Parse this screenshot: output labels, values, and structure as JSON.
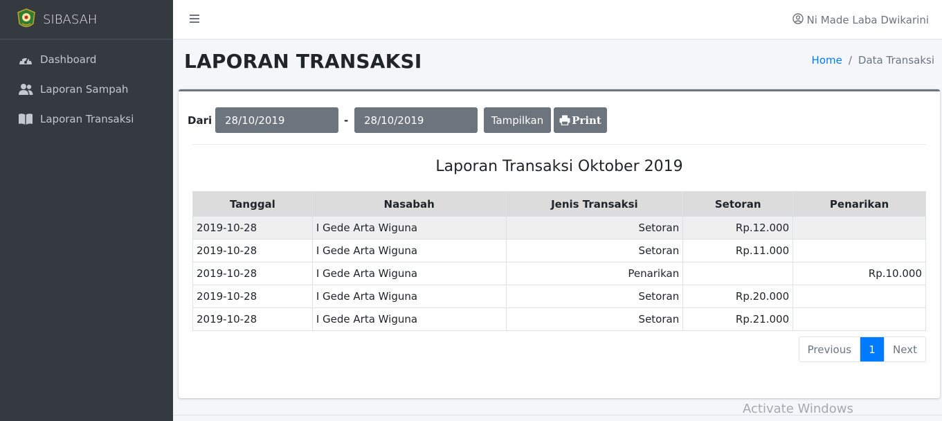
{
  "app": {
    "brand": "SIBASAH"
  },
  "sidebar": {
    "items": [
      {
        "label": "Dashboard",
        "icon": "tachometer-icon"
      },
      {
        "label": "Laporan Sampah",
        "icon": "users-icon"
      },
      {
        "label": "Laporan Transaksi",
        "icon": "book-icon"
      }
    ]
  },
  "navbar": {
    "user": "Ni Made Laba Dwikarini"
  },
  "header": {
    "title": "LAPORAN TRANSAKSI",
    "breadcrumb": {
      "home": "Home",
      "separator": "/",
      "current": "Data Transaksi"
    }
  },
  "filter": {
    "label": "Dari",
    "from_value": "28/10/2019",
    "separator": "-",
    "to_value": "28/10/2019",
    "show_label": "Tampilkan",
    "print_label": "Print"
  },
  "report": {
    "title": "Laporan Transaksi Oktober 2019",
    "columns": [
      "Tanggal",
      "Nasabah",
      "Jenis Transaksi",
      "Setoran",
      "Penarikan"
    ],
    "rows": [
      [
        "2019-10-28",
        "I Gede Arta Wiguna",
        "Setoran",
        "Rp.12.000",
        ""
      ],
      [
        "2019-10-28",
        "I Gede Arta Wiguna",
        "Setoran",
        "Rp.11.000",
        ""
      ],
      [
        "2019-10-28",
        "I Gede Arta Wiguna",
        "Penarikan",
        "",
        "Rp.10.000"
      ],
      [
        "2019-10-28",
        "I Gede Arta Wiguna",
        "Setoran",
        "Rp.20.000",
        ""
      ],
      [
        "2019-10-28",
        "I Gede Arta Wiguna",
        "Setoran",
        "Rp.21.000",
        ""
      ]
    ]
  },
  "pagination": {
    "previous": "Previous",
    "current": "1",
    "next": "Next"
  },
  "watermark": "Activate Windows",
  "colors": {
    "sidebar": "#343a40",
    "primary": "#007bff",
    "secondary": "#6c757d"
  }
}
